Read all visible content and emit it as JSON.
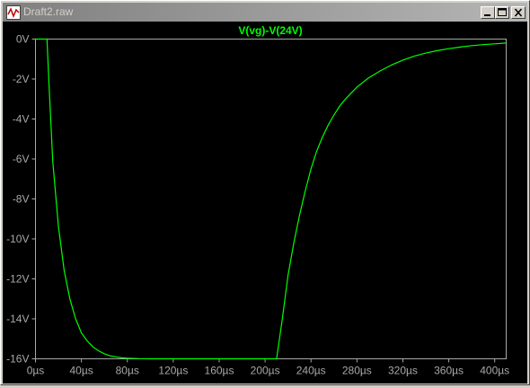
{
  "window": {
    "title": "Draft2.raw",
    "icon": "waveform-icon",
    "buttons": {
      "minimize": "minimize-icon",
      "maximize": "maximize-icon",
      "close": "close-icon"
    }
  },
  "colors": {
    "trace": "#00ff00",
    "plot_background": "#000000",
    "axis": "#a8a8a8",
    "title_bar": "#808080"
  },
  "chart_data": {
    "type": "line",
    "title": "V(vg)-V(24V)",
    "xlabel": "",
    "ylabel": "",
    "xlim": [
      0,
      410
    ],
    "ylim": [
      -16,
      0
    ],
    "x_unit": "µs",
    "y_unit": "V",
    "x_ticks": [
      "0µs",
      "40µs",
      "80µs",
      "120µs",
      "160µs",
      "200µs",
      "240µs",
      "280µs",
      "320µs",
      "360µs",
      "400µs"
    ],
    "y_ticks": [
      "0V",
      "-2V",
      "-4V",
      "-6V",
      "-8V",
      "-10V",
      "-12V",
      "-14V",
      "-16V"
    ],
    "grid": false,
    "series": [
      {
        "name": "V(vg)-V(24V)",
        "x": [
          0,
          10,
          12,
          15,
          20,
          25,
          30,
          35,
          40,
          45,
          50,
          55,
          60,
          65,
          70,
          75,
          80,
          90,
          100,
          120,
          140,
          160,
          180,
          200,
          210,
          215,
          220,
          225,
          230,
          235,
          240,
          245,
          250,
          255,
          260,
          265,
          270,
          275,
          280,
          290,
          300,
          310,
          320,
          330,
          340,
          350,
          360,
          370,
          380,
          390,
          400,
          410
        ],
        "y": [
          0,
          0,
          -2.5,
          -6.1,
          -9.4,
          -11.6,
          -13.0,
          -14.0,
          -14.7,
          -15.1,
          -15.4,
          -15.6,
          -15.75,
          -15.85,
          -15.9,
          -15.95,
          -15.97,
          -15.99,
          -16,
          -16,
          -16,
          -16,
          -16,
          -16,
          -16,
          -14.0,
          -11.8,
          -10.2,
          -8.8,
          -7.6,
          -6.5,
          -5.6,
          -4.9,
          -4.3,
          -3.8,
          -3.35,
          -3.0,
          -2.7,
          -2.4,
          -1.95,
          -1.6,
          -1.3,
          -1.05,
          -0.85,
          -0.7,
          -0.58,
          -0.48,
          -0.4,
          -0.33,
          -0.28,
          -0.24,
          -0.2
        ]
      }
    ]
  }
}
